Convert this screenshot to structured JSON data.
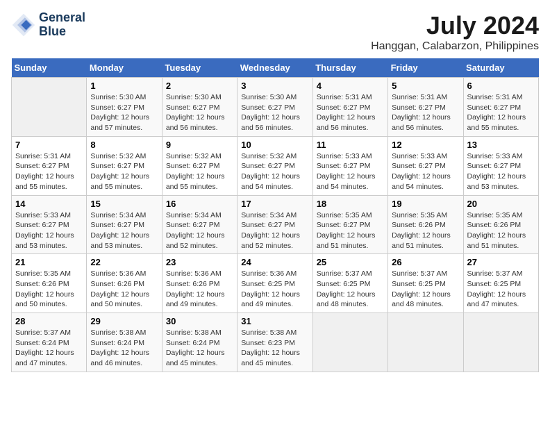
{
  "header": {
    "logo_line1": "General",
    "logo_line2": "Blue",
    "title": "July 2024",
    "subtitle": "Hanggan, Calabarzon, Philippines"
  },
  "days_of_week": [
    "Sunday",
    "Monday",
    "Tuesday",
    "Wednesday",
    "Thursday",
    "Friday",
    "Saturday"
  ],
  "weeks": [
    [
      {
        "day": "",
        "info": ""
      },
      {
        "day": "1",
        "info": "Sunrise: 5:30 AM\nSunset: 6:27 PM\nDaylight: 12 hours\nand 57 minutes."
      },
      {
        "day": "2",
        "info": "Sunrise: 5:30 AM\nSunset: 6:27 PM\nDaylight: 12 hours\nand 56 minutes."
      },
      {
        "day": "3",
        "info": "Sunrise: 5:30 AM\nSunset: 6:27 PM\nDaylight: 12 hours\nand 56 minutes."
      },
      {
        "day": "4",
        "info": "Sunrise: 5:31 AM\nSunset: 6:27 PM\nDaylight: 12 hours\nand 56 minutes."
      },
      {
        "day": "5",
        "info": "Sunrise: 5:31 AM\nSunset: 6:27 PM\nDaylight: 12 hours\nand 56 minutes."
      },
      {
        "day": "6",
        "info": "Sunrise: 5:31 AM\nSunset: 6:27 PM\nDaylight: 12 hours\nand 55 minutes."
      }
    ],
    [
      {
        "day": "7",
        "info": "Sunrise: 5:31 AM\nSunset: 6:27 PM\nDaylight: 12 hours\nand 55 minutes."
      },
      {
        "day": "8",
        "info": "Sunrise: 5:32 AM\nSunset: 6:27 PM\nDaylight: 12 hours\nand 55 minutes."
      },
      {
        "day": "9",
        "info": "Sunrise: 5:32 AM\nSunset: 6:27 PM\nDaylight: 12 hours\nand 55 minutes."
      },
      {
        "day": "10",
        "info": "Sunrise: 5:32 AM\nSunset: 6:27 PM\nDaylight: 12 hours\nand 54 minutes."
      },
      {
        "day": "11",
        "info": "Sunrise: 5:33 AM\nSunset: 6:27 PM\nDaylight: 12 hours\nand 54 minutes."
      },
      {
        "day": "12",
        "info": "Sunrise: 5:33 AM\nSunset: 6:27 PM\nDaylight: 12 hours\nand 54 minutes."
      },
      {
        "day": "13",
        "info": "Sunrise: 5:33 AM\nSunset: 6:27 PM\nDaylight: 12 hours\nand 53 minutes."
      }
    ],
    [
      {
        "day": "14",
        "info": "Sunrise: 5:33 AM\nSunset: 6:27 PM\nDaylight: 12 hours\nand 53 minutes."
      },
      {
        "day": "15",
        "info": "Sunrise: 5:34 AM\nSunset: 6:27 PM\nDaylight: 12 hours\nand 53 minutes."
      },
      {
        "day": "16",
        "info": "Sunrise: 5:34 AM\nSunset: 6:27 PM\nDaylight: 12 hours\nand 52 minutes."
      },
      {
        "day": "17",
        "info": "Sunrise: 5:34 AM\nSunset: 6:27 PM\nDaylight: 12 hours\nand 52 minutes."
      },
      {
        "day": "18",
        "info": "Sunrise: 5:35 AM\nSunset: 6:27 PM\nDaylight: 12 hours\nand 51 minutes."
      },
      {
        "day": "19",
        "info": "Sunrise: 5:35 AM\nSunset: 6:26 PM\nDaylight: 12 hours\nand 51 minutes."
      },
      {
        "day": "20",
        "info": "Sunrise: 5:35 AM\nSunset: 6:26 PM\nDaylight: 12 hours\nand 51 minutes."
      }
    ],
    [
      {
        "day": "21",
        "info": "Sunrise: 5:35 AM\nSunset: 6:26 PM\nDaylight: 12 hours\nand 50 minutes."
      },
      {
        "day": "22",
        "info": "Sunrise: 5:36 AM\nSunset: 6:26 PM\nDaylight: 12 hours\nand 50 minutes."
      },
      {
        "day": "23",
        "info": "Sunrise: 5:36 AM\nSunset: 6:26 PM\nDaylight: 12 hours\nand 49 minutes."
      },
      {
        "day": "24",
        "info": "Sunrise: 5:36 AM\nSunset: 6:25 PM\nDaylight: 12 hours\nand 49 minutes."
      },
      {
        "day": "25",
        "info": "Sunrise: 5:37 AM\nSunset: 6:25 PM\nDaylight: 12 hours\nand 48 minutes."
      },
      {
        "day": "26",
        "info": "Sunrise: 5:37 AM\nSunset: 6:25 PM\nDaylight: 12 hours\nand 48 minutes."
      },
      {
        "day": "27",
        "info": "Sunrise: 5:37 AM\nSunset: 6:25 PM\nDaylight: 12 hours\nand 47 minutes."
      }
    ],
    [
      {
        "day": "28",
        "info": "Sunrise: 5:37 AM\nSunset: 6:24 PM\nDaylight: 12 hours\nand 47 minutes."
      },
      {
        "day": "29",
        "info": "Sunrise: 5:38 AM\nSunset: 6:24 PM\nDaylight: 12 hours\nand 46 minutes."
      },
      {
        "day": "30",
        "info": "Sunrise: 5:38 AM\nSunset: 6:24 PM\nDaylight: 12 hours\nand 45 minutes."
      },
      {
        "day": "31",
        "info": "Sunrise: 5:38 AM\nSunset: 6:23 PM\nDaylight: 12 hours\nand 45 minutes."
      },
      {
        "day": "",
        "info": ""
      },
      {
        "day": "",
        "info": ""
      },
      {
        "day": "",
        "info": ""
      }
    ]
  ]
}
